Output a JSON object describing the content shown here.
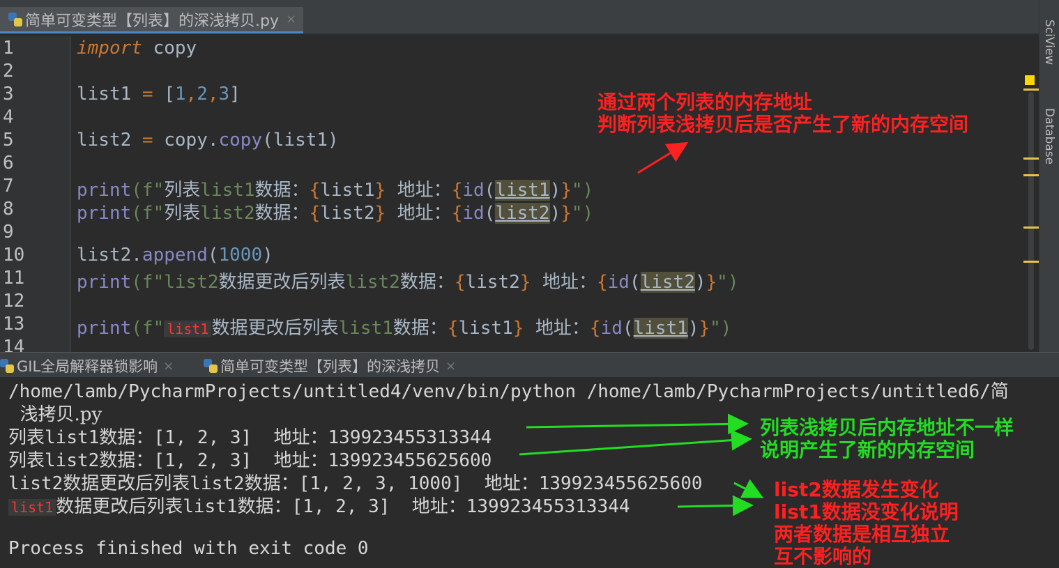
{
  "editor_tab": {
    "title": "简单可变类型【列表】的深浅拷贝.py",
    "close": "×"
  },
  "side_panel": {
    "sciview": "SciView",
    "database": "Database"
  },
  "code_lines": [
    {
      "n": "1"
    },
    {
      "n": "2"
    },
    {
      "n": "3"
    },
    {
      "n": "4"
    },
    {
      "n": "5"
    },
    {
      "n": "6"
    },
    {
      "n": "7"
    },
    {
      "n": "8"
    },
    {
      "n": "9"
    },
    {
      "n": "10"
    },
    {
      "n": "11"
    },
    {
      "n": "12"
    },
    {
      "n": "13"
    },
    {
      "n": "14"
    }
  ],
  "code": {
    "l1_kw": "import",
    "l1_rest": " copy",
    "l3_a": "list1 ",
    "l3_eq": "=",
    "l3_b": " [",
    "l3_n1": "1",
    "l3_c1": ",",
    "l3_n2": "2",
    "l3_c2": ",",
    "l3_n3": "3",
    "l3_c": "]",
    "l5_a": "list2 ",
    "l5_eq": "=",
    "l5_b": " copy.",
    "l5_fn": "copy",
    "l5_c": "(list1)",
    "l7_print": "print",
    "l7_a": "(f\"",
    "l7_cn1": "列表",
    "l7_b": "list1",
    "l7_cn2": "数据：",
    "l7_v": "list1",
    "l7_cn3": "  地址：",
    "l7_id": "id",
    "l7_arg": "list1",
    "l7_end": "\")",
    "l8_print": "print",
    "l8_a": "(f\"",
    "l8_cn1": "列表",
    "l8_b": "list2",
    "l8_cn2": "数据：",
    "l8_v": "list2",
    "l8_cn3": "  地址：",
    "l8_id": "id",
    "l8_arg": "list2",
    "l8_end": "\")",
    "l10_a": "list2.",
    "l10_fn": "append",
    "l10_b": "(",
    "l10_n": "1000",
    "l10_c": ")",
    "l11_print": "print",
    "l11_a": "(f\"list2",
    "l11_cn1": "数据更改后列表",
    "l11_b": "list2",
    "l11_cn2": "数据：",
    "l11_v": "list2",
    "l11_cn3": "  地址：",
    "l11_id": "id",
    "l11_arg": "list2",
    "l11_end": "\")",
    "l13_print": "print",
    "l13_a": "(f\"",
    "l13_tag": "list1",
    "l13_cn1": "数据更改后列表",
    "l13_b": "list1",
    "l13_cn2": "数据：",
    "l13_v": "list1",
    "l13_cn3": "  地址：",
    "l13_id": "id",
    "l13_arg": "list1",
    "l13_end": "\")"
  },
  "run_tabs": [
    {
      "label": "GIL全局解释器锁影响",
      "close": "×"
    },
    {
      "label": "简单可变类型【列表】的深浅拷贝",
      "close": "×"
    }
  ],
  "console": {
    "cmd1": "/home/lamb/PycharmProjects/untitled4/venv/bin/python /home/lamb/PycharmProjects/untitled6/简",
    "cmd2": "  浅拷贝.py",
    "o1_cn1": "列表",
    "o1_a": "list1",
    "o1_cn2": "数据：",
    "o1_v": "[1, 2, 3]  ",
    "o1_cn3": "地址：",
    "o1_addr": "139923455313344",
    "o2_cn1": "列表",
    "o2_a": "list2",
    "o2_cn2": "数据：",
    "o2_v": "[1, 2, 3]  ",
    "o2_cn3": "地址：",
    "o2_addr": "139923455625600",
    "o3_a": "list2",
    "o3_cn1": "数据更改后列表",
    "o3_b": "list2",
    "o3_cn2": "数据：",
    "o3_v": "[1, 2, 3, 1000]  ",
    "o3_cn3": "地址：",
    "o3_addr": "139923455625600",
    "o4_tag": "list1",
    "o4_cn1": "数据更改后列表",
    "o4_b": "list1",
    "o4_cn2": "数据：",
    "o4_v": "[1, 2, 3]  ",
    "o4_cn3": "地址：",
    "o4_addr": "139923455313344",
    "exit": "Process finished with exit code 0"
  },
  "annotations": {
    "red_top_1": "通过两个列表的内存地址",
    "red_top_2": "判断列表浅拷贝后是否产生了新的内存空间",
    "green_1": "列表浅拷贝后内存地址不一样",
    "green_2": "说明产生了新的内存空间",
    "red_b1": "list2数据发生变化",
    "red_b2": "list1数据没变化说明",
    "red_b3": "两者数据是相互独立",
    "red_b4": "互不影响的"
  },
  "colors": {
    "red_annotation": "#ff2020",
    "green_annotation": "#22dd22",
    "tab_accent": "#4a88c7"
  }
}
